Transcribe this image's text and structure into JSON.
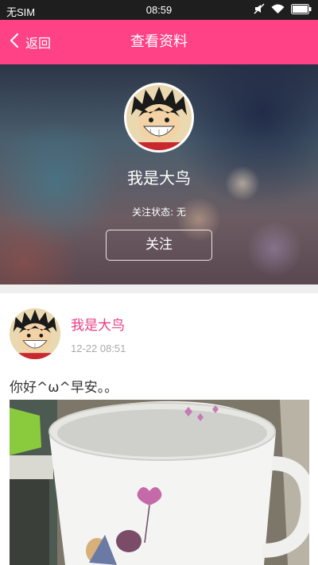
{
  "status_bar": {
    "carrier": "无SIM",
    "time": "08:59",
    "icons": [
      "mute-icon",
      "wifi-icon",
      "battery-icon"
    ]
  },
  "title_bar": {
    "back_label": "返回",
    "title": "查看资料",
    "color": "#ff4285"
  },
  "profile": {
    "name": "我是大鸟",
    "follow_status": "关注状态: 无",
    "follow_button": "关注"
  },
  "post": {
    "author": "我是大鸟",
    "time": "12-22 08:51",
    "text": "你好^ω^早安。。",
    "author_color": "#e93d83"
  }
}
